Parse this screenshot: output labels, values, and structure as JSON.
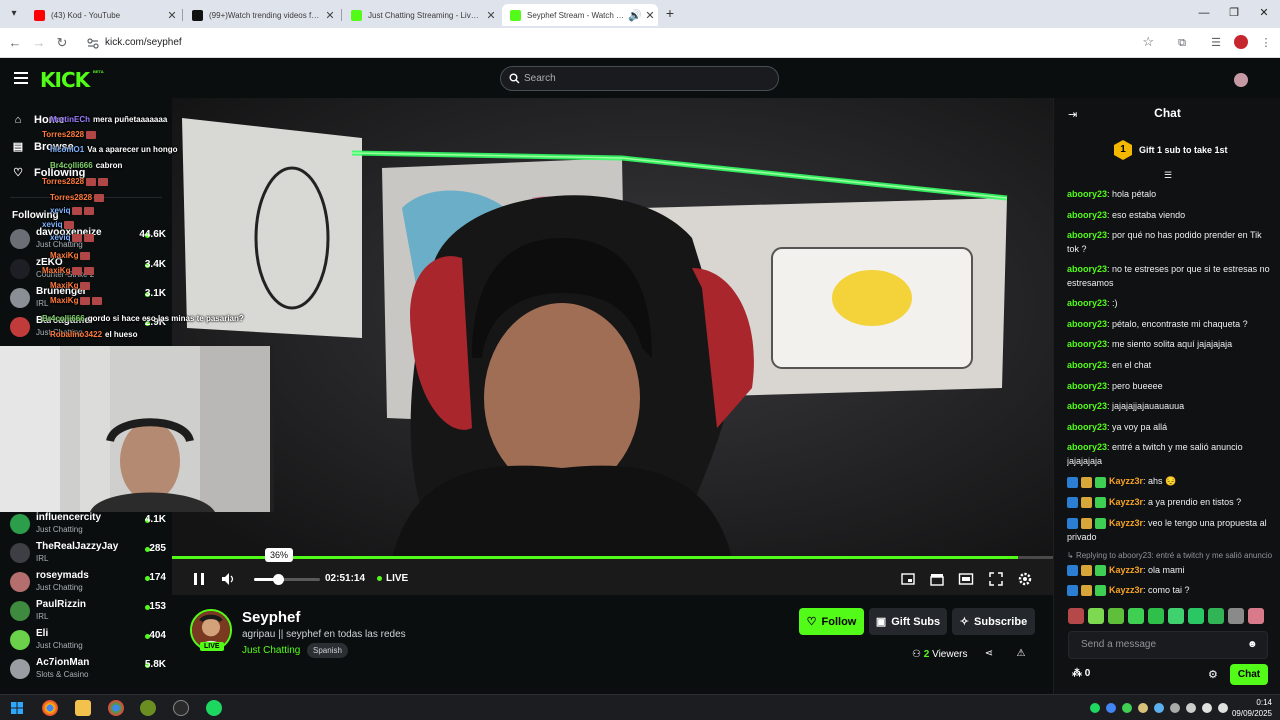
{
  "browser": {
    "tabs": [
      {
        "title": "(43) Kod - YouTube",
        "favicon_color": "#ff0000"
      },
      {
        "title": "(99+)Watch trending videos for you | TikTok",
        "favicon_color": "#111111"
      },
      {
        "title": "Just Chatting Streaming - Live Streams on Kick",
        "favicon_color": "#53fc18"
      },
      {
        "title": "Seyphef Stream - Watch Live on Kick",
        "favicon_color": "#53fc18"
      }
    ],
    "url": "kick.com/seyphef"
  },
  "header": {
    "logo": "KICK",
    "logo_badge": "BETA",
    "search_placeholder": "Search"
  },
  "sidebar": {
    "nav": [
      {
        "label": "Home",
        "icon": "home-icon"
      },
      {
        "label": "Browse",
        "icon": "browse-icon"
      },
      {
        "label": "Following",
        "icon": "heart-icon"
      }
    ],
    "following_heading": "Following",
    "channels": [
      {
        "name": "davooxeneize",
        "category": "Just Chatting",
        "viewers": "44.6K",
        "color": "#6b6f75"
      },
      {
        "name": "zEKO",
        "category": "Counter-Strike 2",
        "viewers": "3.4K",
        "color": "#1d1f24"
      },
      {
        "name": "Brunenger",
        "category": "IRL",
        "viewers": "3.1K",
        "color": "#8a8f96"
      },
      {
        "name": "Barcagamer",
        "category": "Just Chatting",
        "viewers": "2.9K",
        "color": "#c23b3b"
      },
      {
        "name": "influencercity",
        "category": "Just Chatting",
        "viewers": "4.1K",
        "color": "#2c9e4b"
      },
      {
        "name": "TheRealJazzyJay",
        "category": "IRL",
        "viewers": "285",
        "color": "#3d3f44"
      },
      {
        "name": "roseymads",
        "category": "Just Chatting",
        "viewers": "174",
        "color": "#b56e6e"
      },
      {
        "name": "PaulRizzin",
        "category": "IRL",
        "viewers": "153",
        "color": "#3e8a3e"
      },
      {
        "name": "Eli",
        "category": "Just Chatting",
        "viewers": "404",
        "color": "#6bd04a"
      },
      {
        "name": "Ac7ionMan",
        "category": "Slots & Casino",
        "viewers": "5.8K",
        "color": "#9a9ea3"
      }
    ]
  },
  "pip_chat": [
    {
      "user": "MartinECh",
      "msg": "mera puñetaaaaaaa",
      "user_color": "#9b7bff"
    },
    {
      "user": "Torres2828",
      "msg": "",
      "user_color": "#ff7a3d"
    },
    {
      "user": "hicomO1",
      "msg": "Va a aparecer un hongo",
      "user_color": "#7fb3ff"
    },
    {
      "user": "Br4colli666",
      "msg": "cabron",
      "user_color": "#7fd46b"
    },
    {
      "user": "Torres2828",
      "msg": "",
      "user_color": "#ff7a3d"
    },
    {
      "user": "Torres2828",
      "msg": "",
      "user_color": "#ff7a3d"
    },
    {
      "user": "xeviq",
      "msg": "",
      "user_color": "#7fb3ff"
    },
    {
      "user": "xeviq",
      "msg": "",
      "user_color": "#7fb3ff"
    },
    {
      "user": "xeviq",
      "msg": "",
      "user_color": "#7fb3ff"
    },
    {
      "user": "MaxiKg",
      "msg": "",
      "user_color": "#ff7a3d"
    },
    {
      "user": "MaxiKg",
      "msg": "",
      "user_color": "#ff7a3d"
    },
    {
      "user": "MaxiKg",
      "msg": "",
      "user_color": "#ff7a3d"
    },
    {
      "user": "MaxiKg",
      "msg": "",
      "user_color": "#ff7a3d"
    },
    {
      "user": "Br4colli666",
      "msg": "gordo si hace eso las minas te pasarian?",
      "user_color": "#7fd46b"
    },
    {
      "user": "Robalino3422",
      "msg": "el hueso",
      "user_color": "#ff7a3d"
    }
  ],
  "player": {
    "progress_fraction": 0.96,
    "volume_percent_label": "36%",
    "volume_fraction": 0.36,
    "time": "02:51:14",
    "live_label": "LIVE"
  },
  "stream": {
    "streamer": "Seyphef",
    "live_badge": "LIVE",
    "title": "agripau || seyphef en todas las redes",
    "category": "Just Chatting",
    "language": "Spanish",
    "follow_label": "Follow",
    "gift_subs_label": "Gift Subs",
    "subscribe_label": "Subscribe",
    "viewers_count": "2",
    "viewers_label": "Viewers"
  },
  "chat": {
    "title": "Chat",
    "gift_count": "1",
    "gift_text": "Gift 1 sub to take 1st",
    "messages": [
      {
        "user": "aboory23",
        "text": "hola pétalo",
        "badges": 0,
        "user_color": "#53fc18",
        "lines": 1
      },
      {
        "user": "aboory23",
        "text": "eso estaba viendo",
        "badges": 0,
        "user_color": "#53fc18",
        "lines": 1
      },
      {
        "user": "aboory23",
        "text": "por qué no has podido prender en Tik tok ?",
        "badges": 0,
        "user_color": "#53fc18",
        "lines": 2
      },
      {
        "user": "aboory23",
        "text": "no te estreses por que si te estresas no estresamos",
        "badges": 0,
        "user_color": "#53fc18",
        "lines": 2
      },
      {
        "user": "aboory23",
        "text": ":)",
        "badges": 0,
        "user_color": "#53fc18",
        "lines": 1
      },
      {
        "user": "aboory23",
        "text": "pétalo, encontraste mi chaqueta ?",
        "badges": 0,
        "user_color": "#53fc18",
        "lines": 1
      },
      {
        "user": "aboory23",
        "text": "me siento solita aquí jajajajaja",
        "badges": 0,
        "user_color": "#53fc18",
        "lines": 1
      },
      {
        "user": "aboory23",
        "text": "en el chat",
        "badges": 0,
        "user_color": "#53fc18",
        "lines": 1
      },
      {
        "user": "aboory23",
        "text": "pero bueeee",
        "badges": 0,
        "user_color": "#53fc18",
        "lines": 1
      },
      {
        "user": "aboory23",
        "text": "jajajajjajauauauua",
        "badges": 0,
        "user_color": "#53fc18",
        "lines": 1
      },
      {
        "user": "aboory23",
        "text": "ya voy pa allá",
        "badges": 0,
        "user_color": "#53fc18",
        "lines": 1
      },
      {
        "user": "aboory23",
        "text": "entré a twitch y me salió anuncio jajajajaja",
        "badges": 0,
        "user_color": "#53fc18",
        "lines": 2
      },
      {
        "user": "Kayzz3r",
        "text": "ahs 😔",
        "badges": 3,
        "user_color": "#f7a325",
        "lines": 1
      },
      {
        "user": "Kayzz3r",
        "text": "a ya prendio en tistos ?",
        "badges": 3,
        "user_color": "#f7a325",
        "lines": 1
      },
      {
        "user": "Kayzz3r",
        "text": "veo le tengo una propuesta al privado",
        "badges": 3,
        "user_color": "#f7a325",
        "lines": 2
      },
      {
        "reply": "Replying to aboory23: entré a twitch y me salió anuncio jajajajaja"
      },
      {
        "user": "Kayzz3r",
        "text": "ola mami",
        "badges": 3,
        "user_color": "#f7a325",
        "lines": 1
      },
      {
        "user": "Kayzz3r",
        "text": "como tai ?",
        "badges": 3,
        "user_color": "#f7a325",
        "lines": 1
      }
    ],
    "input_placeholder": "Send a message",
    "points": "0",
    "send_label": "Chat"
  },
  "taskbar": {
    "time": "0:14",
    "date": "09/09/2025"
  }
}
